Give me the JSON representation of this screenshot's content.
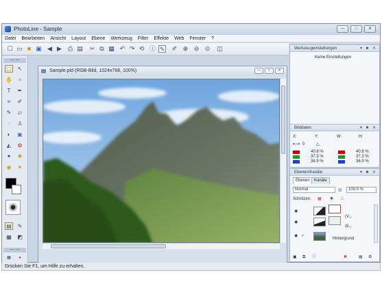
{
  "app": {
    "title": "PhotoLine - Sample",
    "window_buttons": [
      "—",
      "□",
      "✕"
    ]
  },
  "menu": [
    "Datei",
    "Bearbeiten",
    "Ansicht",
    "Layout",
    "Ebene",
    "Werkzeug",
    "Filter",
    "Effekte",
    "Web",
    "Fenster",
    "?"
  ],
  "toolbar_icons": [
    "new-document",
    "open-folder",
    "save",
    "back",
    "forward",
    "print",
    "scan",
    "cut",
    "copy",
    "paste",
    "undo",
    "redo",
    "rotate",
    "info",
    "brush",
    "eyedropper",
    "zoom-in",
    "zoom-out",
    "zoom-fit",
    "zoom-actual"
  ],
  "tool_palette": {
    "header": "— —",
    "tools": [
      "select",
      "move",
      "hand",
      "zoom",
      "text",
      "crop",
      "eraser",
      "brush",
      "pen",
      "stamp",
      "gradient",
      "fill",
      "smudge",
      "shape",
      "lasso",
      "wand"
    ],
    "fg_color": "#000000",
    "bg_color": "#ffffff"
  },
  "document": {
    "title": "Sample.pld  (RGB-Bild, 1024x768, 100%)",
    "buttons": [
      "—",
      "□",
      "✕"
    ]
  },
  "panels": {
    "werkzeug": {
      "title": "Werkzeugeinstellungen",
      "ctrl": "▾ ■ ✕",
      "empty_text": "Keine Einstellungen"
    },
    "bilddaten": {
      "title": "Bilddaten",
      "ctrl": "▾ ■ ✕",
      "labels": {
        "x": "X:",
        "y": "Y:",
        "w": "W:",
        "h": "H:"
      },
      "angle": "0",
      "left_values": [
        "40.8 %",
        "37.3 %",
        "36.9 %"
      ],
      "right_values": [
        "40.8 %",
        "37.3 %",
        "36.9 %"
      ]
    },
    "ebenen": {
      "title": "Ebenen/Kanäle",
      "ctrl": "▾ ■ ✕",
      "tabs": [
        "Ebenen",
        "Kanäle"
      ],
      "blend_mode": "Normal",
      "opacity": "100.0 %",
      "protect_label": "Schützen:",
      "layers": [
        {
          "name": ""
        },
        {
          "name": "(V..."
        },
        {
          "name": "(8..."
        },
        {
          "name": "Hintergrund"
        }
      ]
    }
  },
  "status": "Drücken Sie F1, um Hilfe zu erhalten."
}
